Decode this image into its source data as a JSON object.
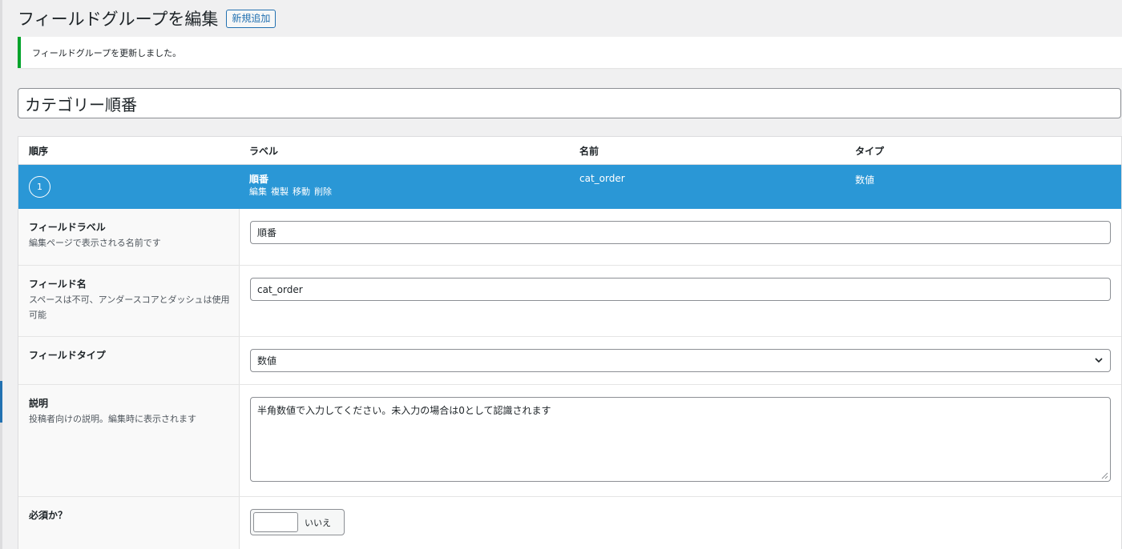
{
  "header": {
    "title": "フィールドグループを編集",
    "add_new_label": "新規追加"
  },
  "notice": {
    "message": "フィールドグループを更新しました。",
    "color": "#00a32a"
  },
  "group": {
    "title_value": "カテゴリー順番"
  },
  "table": {
    "columns": {
      "order": "順序",
      "label": "ラベル",
      "name": "名前",
      "type": "タイプ"
    },
    "row": {
      "order": "1",
      "label": "順番",
      "actions": {
        "edit": "編集",
        "duplicate": "複製",
        "move": "移動",
        "delete": "削除"
      },
      "name": "cat_order",
      "type": "数値",
      "highlight_color": "#2a97d6"
    }
  },
  "settings": {
    "field_label": {
      "title": "フィールドラベル",
      "desc": "編集ページで表示される名前です",
      "value": "順番"
    },
    "field_name": {
      "title": "フィールド名",
      "desc": "スペースは不可、アンダースコアとダッシュは使用可能",
      "value": "cat_order"
    },
    "field_type": {
      "title": "フィールドタイプ",
      "value": "数値"
    },
    "description": {
      "title": "説明",
      "desc": "投稿者向けの説明。編集時に表示されます",
      "value": "半角数値で入力してください。未入力の場合は0として認識されます"
    },
    "required": {
      "title": "必須か？",
      "toggle_label": "いいえ"
    }
  }
}
